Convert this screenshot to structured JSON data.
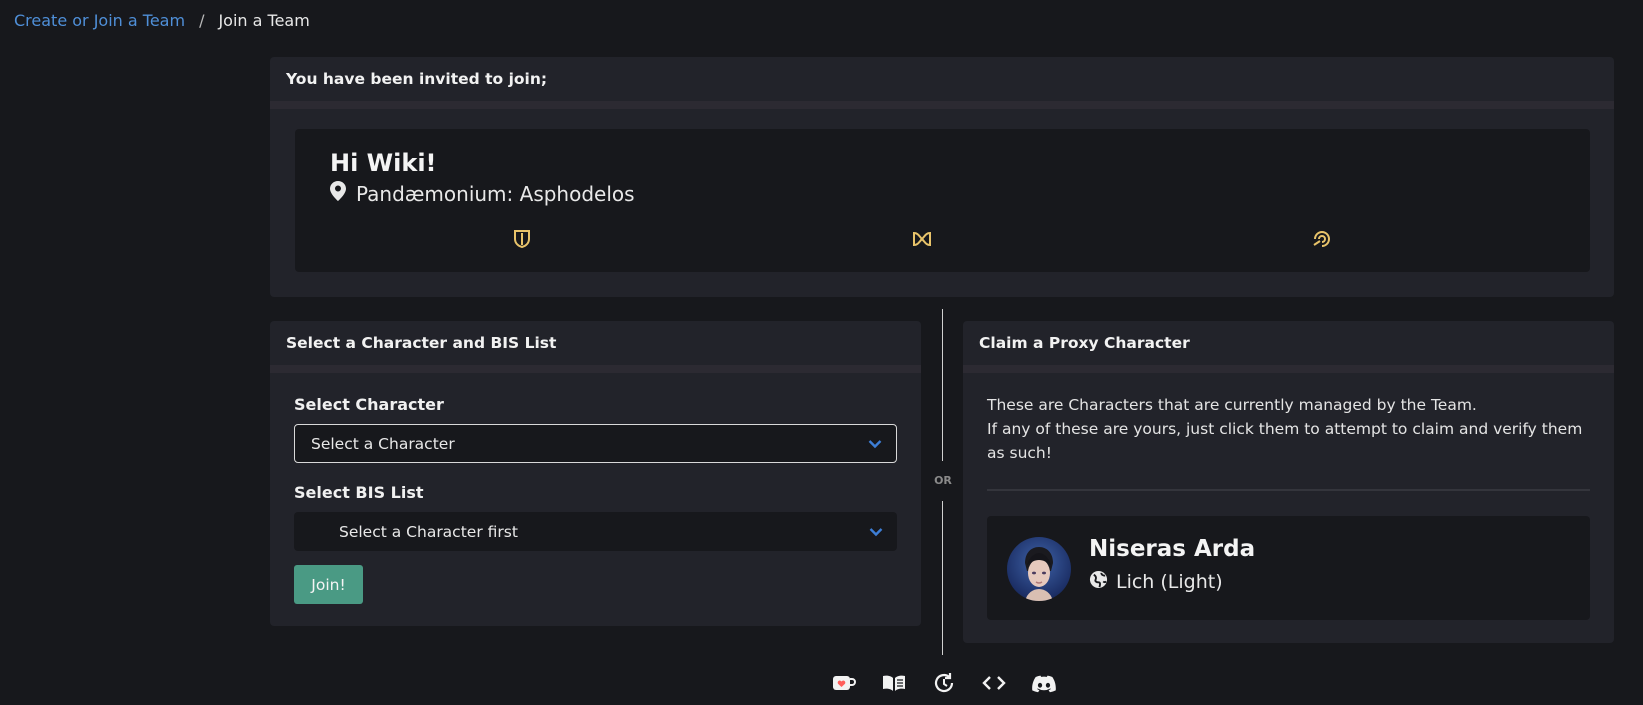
{
  "breadcrumb": {
    "parent": "Create or Join a Team",
    "separator": "/",
    "current": "Join a Team"
  },
  "invite": {
    "header": "You have been invited to join;",
    "team_name": "Hi Wiki!",
    "tier": "Pandæmonium: Asphodelos",
    "role_icons": [
      "tank-icon",
      "healer-icon",
      "dps-icon"
    ]
  },
  "select": {
    "header": "Select a Character and BIS List",
    "character_label": "Select Character",
    "character_value": "Select a Character",
    "bis_label": "Select BIS List",
    "bis_value": "Select a Character first",
    "join_label": "Join!"
  },
  "divider": {
    "or": "OR"
  },
  "proxy": {
    "header": "Claim a Proxy Character",
    "line1": "These are Characters that are currently managed by the Team.",
    "line2": "If any of these are yours, just click them to attempt to claim and verify them as such!",
    "character": {
      "name": "Niseras Arda",
      "world": "Lich (Light)"
    }
  },
  "footer": {
    "icons": [
      "kofi-icon",
      "docs-book-icon",
      "changelog-icon",
      "api-code-icon",
      "discord-icon"
    ]
  },
  "colors": {
    "background": "#17181c",
    "card": "#22232a",
    "link": "#4f8fd8",
    "accent_chevron": "#3d7ed6",
    "join_button": "#4a9a84",
    "role_icon": "#e8c36a"
  }
}
